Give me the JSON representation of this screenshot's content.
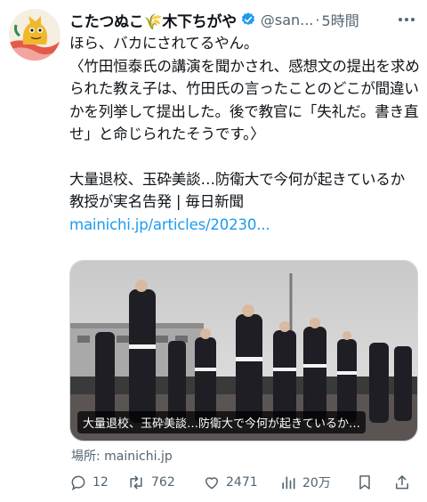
{
  "tweet": {
    "author_name": "こたつぬこ🌾木下ちがや",
    "handle": "@san...",
    "separator": "·",
    "time": "5時間",
    "paragraph_1": "ほら、バカにされてるやん。\n〈竹田恒泰氏の講演を聞かされ、感想文の提出を求められた教え子は、竹田氏の言ったことのどこが間違いかを列挙して提出した。後で教官に「失礼だ。書き直せ」と命じられたそうです。〉",
    "paragraph_2_text": "大量退校、玉砕美談…防衛大で今何が起きているか　教授が実名告発 | 毎日新聞 ",
    "paragraph_2_link": "mainichi.jp/articles/20230..."
  },
  "card": {
    "title": "大量退校、玉砕美談…防衛大で今何が起きているか…",
    "source": "場所: mainichi.jp"
  },
  "actions": {
    "replies": "12",
    "retweets": "762",
    "likes": "2471",
    "views": "20万"
  },
  "colors": {
    "link": "#1d9bf0",
    "verified": "#1d9bf0",
    "secondary_text": "#536471"
  },
  "icons": [
    "avatar",
    "verified-badge-icon",
    "more-icon",
    "reply-icon",
    "retweet-icon",
    "like-icon",
    "views-icon",
    "bookmark-icon",
    "share-icon"
  ]
}
